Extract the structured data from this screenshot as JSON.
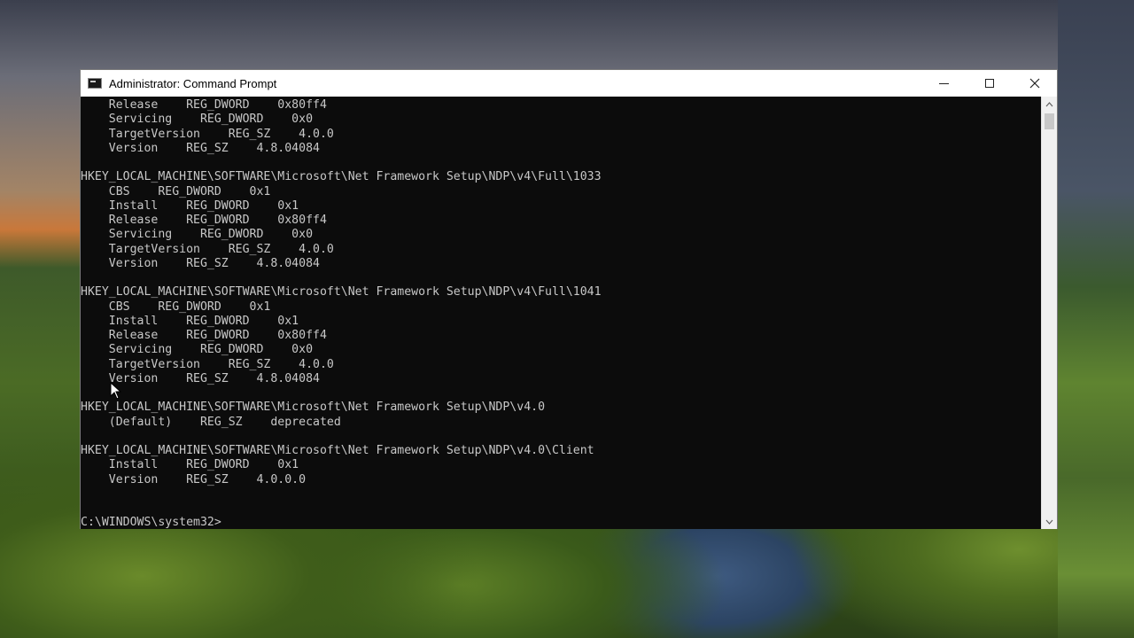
{
  "window": {
    "title": "Administrator: Command Prompt",
    "icon": "cmd-icon",
    "controls": {
      "minimize": "minimize-icon",
      "maximize": "maximize-icon",
      "close": "close-icon"
    }
  },
  "console": {
    "lines": [
      "    Release    REG_DWORD    0x80ff4",
      "    Servicing    REG_DWORD    0x0",
      "    TargetVersion    REG_SZ    4.0.0",
      "    Version    REG_SZ    4.8.04084",
      "",
      "HKEY_LOCAL_MACHINE\\SOFTWARE\\Microsoft\\Net Framework Setup\\NDP\\v4\\Full\\1033",
      "    CBS    REG_DWORD    0x1",
      "    Install    REG_DWORD    0x1",
      "    Release    REG_DWORD    0x80ff4",
      "    Servicing    REG_DWORD    0x0",
      "    TargetVersion    REG_SZ    4.0.0",
      "    Version    REG_SZ    4.8.04084",
      "",
      "HKEY_LOCAL_MACHINE\\SOFTWARE\\Microsoft\\Net Framework Setup\\NDP\\v4\\Full\\1041",
      "    CBS    REG_DWORD    0x1",
      "    Install    REG_DWORD    0x1",
      "    Release    REG_DWORD    0x80ff4",
      "    Servicing    REG_DWORD    0x0",
      "    TargetVersion    REG_SZ    4.0.0",
      "    Version    REG_SZ    4.8.04084",
      "",
      "HKEY_LOCAL_MACHINE\\SOFTWARE\\Microsoft\\Net Framework Setup\\NDP\\v4.0",
      "    (Default)    REG_SZ    deprecated",
      "",
      "HKEY_LOCAL_MACHINE\\SOFTWARE\\Microsoft\\Net Framework Setup\\NDP\\v4.0\\Client",
      "    Install    REG_DWORD    0x1",
      "    Version    REG_SZ    4.0.0.0",
      "",
      "",
      "C:\\WINDOWS\\system32>"
    ]
  },
  "colors": {
    "console_bg": "#0c0c0c",
    "console_text": "#c8c8c8",
    "titlebar_bg": "#ffffff"
  }
}
